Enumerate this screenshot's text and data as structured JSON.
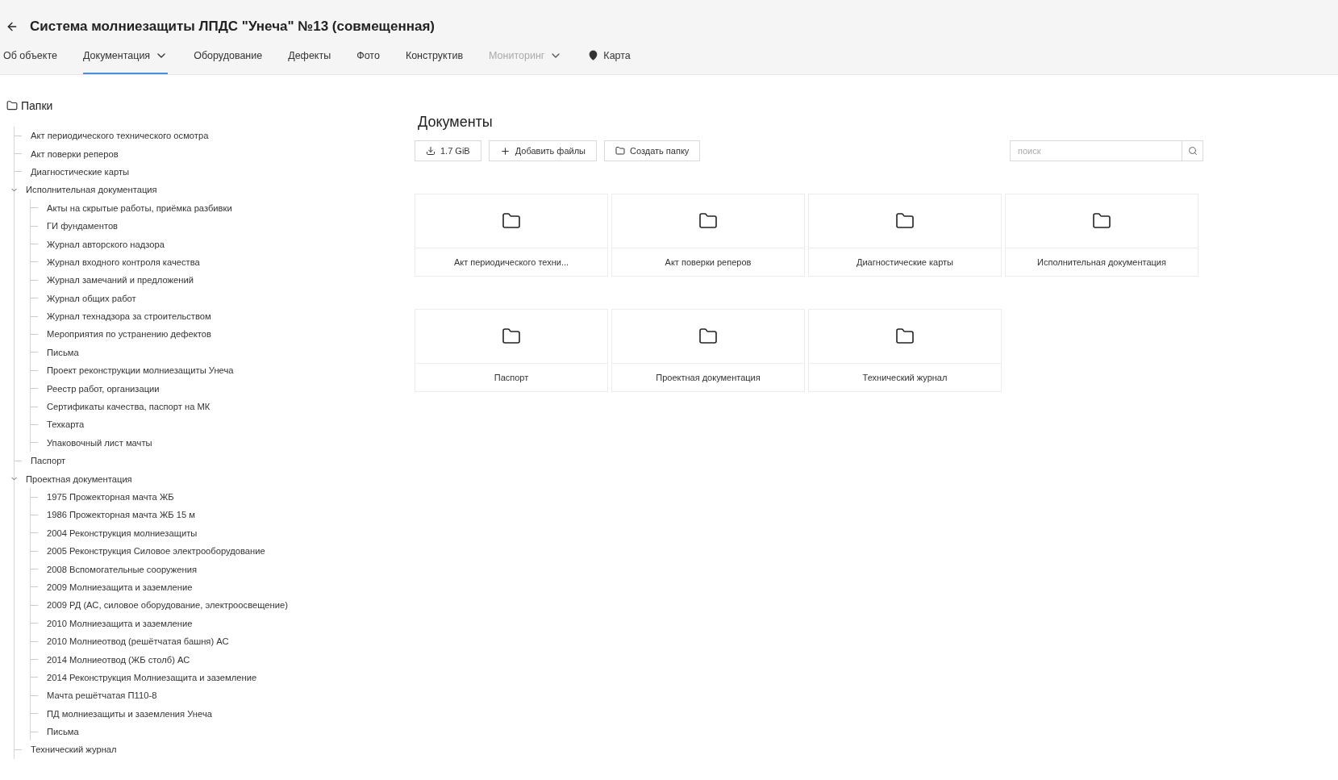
{
  "header": {
    "title": "Система молниезащиты ЛПДС \"Унеча\" №13 (совмещенная)"
  },
  "tabs": [
    {
      "label": "Об объекте",
      "kind": "plain",
      "selected": false,
      "disabled": false
    },
    {
      "label": "Документация",
      "kind": "dropdown",
      "selected": true,
      "disabled": false
    },
    {
      "label": "Оборудование",
      "kind": "plain",
      "selected": false,
      "disabled": false
    },
    {
      "label": "Дефекты",
      "kind": "plain",
      "selected": false,
      "disabled": false
    },
    {
      "label": "Фото",
      "kind": "plain",
      "selected": false,
      "disabled": false
    },
    {
      "label": "Конструктив",
      "kind": "plain",
      "selected": false,
      "disabled": false
    },
    {
      "label": "Мониторинг",
      "kind": "dropdown",
      "selected": false,
      "disabled": true
    },
    {
      "label": "Карта",
      "kind": "location",
      "selected": false,
      "disabled": false
    }
  ],
  "sidebar": {
    "title": "Папки",
    "tree": [
      {
        "label": "Акт периодического технического осмотра"
      },
      {
        "label": "Акт поверки реперов"
      },
      {
        "label": "Диагностические карты"
      },
      {
        "label": "Исполнительная документация",
        "expanded": true,
        "children": [
          {
            "label": "Акты на скрытые работы, приёмка разбивки"
          },
          {
            "label": "ГИ фундаментов"
          },
          {
            "label": "Журнал авторского надзора"
          },
          {
            "label": "Журнал входного контроля качества"
          },
          {
            "label": "Журнал замечаний и предложений"
          },
          {
            "label": "Журнал общих работ"
          },
          {
            "label": "Журнал технадзора за строительством"
          },
          {
            "label": "Мероприятия по устранению дефектов"
          },
          {
            "label": "Письма"
          },
          {
            "label": "Проект реконструкции молниезащиты Унеча"
          },
          {
            "label": "Реестр работ, организации"
          },
          {
            "label": "Сертификаты качества, паспорт на МК"
          },
          {
            "label": "Техкарта"
          },
          {
            "label": "Упаковочный лист мачты"
          }
        ]
      },
      {
        "label": "Паспорт"
      },
      {
        "label": "Проектная документация",
        "expanded": true,
        "children": [
          {
            "label": "1975 Прожекторная мачта ЖБ"
          },
          {
            "label": "1986 Прожекторная мачта ЖБ 15 м"
          },
          {
            "label": "2004 Реконструкция молниезащиты"
          },
          {
            "label": "2005 Реконструкция Силовое электрооборудование"
          },
          {
            "label": "2008 Вспомогательные сооружения"
          },
          {
            "label": "2009 Молниезащита и заземление"
          },
          {
            "label": "2009 РД (АС, силовое оборудование, электроосвещение)"
          },
          {
            "label": "2010 Молниезащита и заземление"
          },
          {
            "label": "2010 Молниеотвод (решётчатая башня) АС"
          },
          {
            "label": "2014 Молниеотвод (ЖБ столб) АС"
          },
          {
            "label": "2014 Реконструкция Молниезащита и заземление"
          },
          {
            "label": "Мачта решётчатая П110-8"
          },
          {
            "label": "ПД молниезащиты и заземления Унеча"
          },
          {
            "label": "Письма"
          }
        ]
      },
      {
        "label": "Технический журнал"
      }
    ]
  },
  "documents": {
    "title": "Документы",
    "toolbar": [
      {
        "label": "1.7 GiB",
        "kind": "download"
      },
      {
        "label": "Добавить файлы",
        "kind": "add"
      },
      {
        "label": "Создать папку",
        "kind": "folder"
      }
    ],
    "search": {
      "placeholder": "поиск"
    },
    "folders": [
      "Акт периодического техни...",
      "Акт поверки реперов",
      "Диагностические карты",
      "Исполнительная документация",
      "Паспорт",
      "Проектная документация",
      "Технический журнал"
    ]
  }
}
